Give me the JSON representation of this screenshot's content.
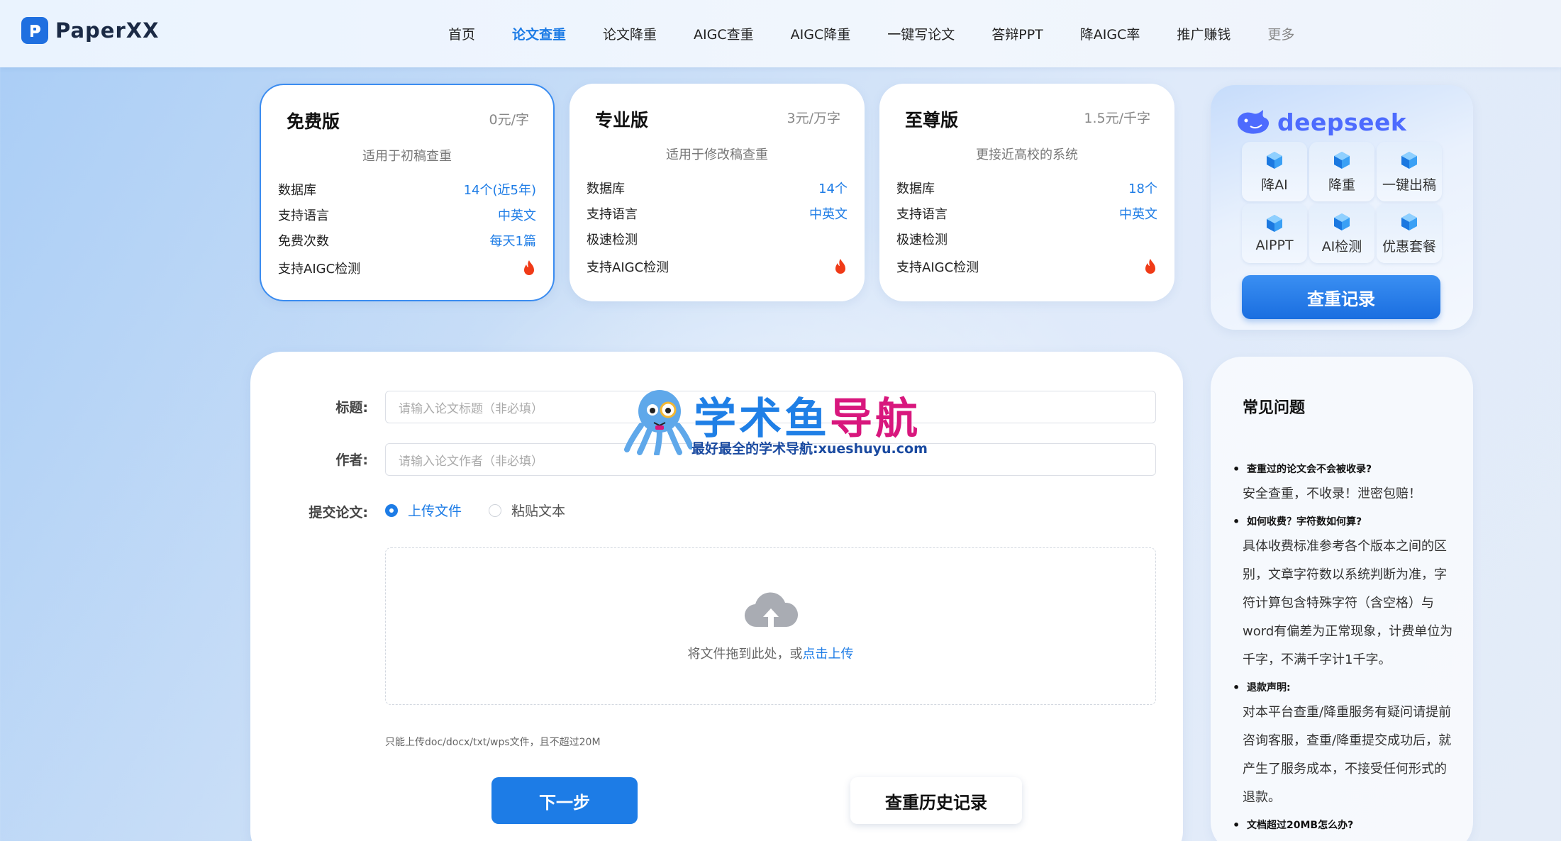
{
  "header": {
    "logo_text": "PaperXX",
    "nav": [
      "首页",
      "论文查重",
      "论文降重",
      "AIGC查重",
      "AIGC降重",
      "一键写论文",
      "答辩PPT",
      "降AIGC率",
      "推广赚钱",
      "更多"
    ],
    "active_index": 1
  },
  "plans": [
    {
      "name": "免费版",
      "price": "0元/字",
      "desc": "适用于初稿查重",
      "rows": [
        {
          "label": "数据库",
          "value": "14个(近5年)"
        },
        {
          "label": "支持语言",
          "value": "中英文"
        },
        {
          "label": "免费次数",
          "value": "每天1篇"
        },
        {
          "label": "支持AIGC检测",
          "value": ""
        }
      ]
    },
    {
      "name": "专业版",
      "price": "3元/万字",
      "desc": "适用于修改稿查重",
      "rows": [
        {
          "label": "数据库",
          "value": "14个"
        },
        {
          "label": "支持语言",
          "value": "中英文"
        },
        {
          "label": "极速检测",
          "value": ""
        },
        {
          "label": "支持AIGC检测",
          "value": ""
        }
      ]
    },
    {
      "name": "至尊版",
      "price": "1.5元/千字",
      "desc": "更接近高校的系统",
      "rows": [
        {
          "label": "数据库",
          "value": "18个"
        },
        {
          "label": "支持语言",
          "value": "中英文"
        },
        {
          "label": "极速检测",
          "value": ""
        },
        {
          "label": "支持AIGC检测",
          "value": ""
        }
      ]
    }
  ],
  "deepseek": {
    "logo_text": "deepseek",
    "tiles": [
      "降AI",
      "降重",
      "一键出稿",
      "AIPPT",
      "AI检测",
      "优惠套餐"
    ],
    "record_button": "查重记录"
  },
  "form": {
    "title_label": "标题:",
    "title_placeholder": "请输入论文标题（非必填）",
    "author_label": "作者:",
    "author_placeholder": "请输入论文作者（非必填）",
    "submit_label": "提交论文:",
    "option_upload": "上传文件",
    "option_paste": "粘贴文本",
    "upload_hint": "将文件拖到此处，或",
    "upload_link": "点击上传",
    "upload_note": "只能上传doc/docx/txt/wps文件，且不超过20M",
    "next_button": "下一步",
    "history_button": "查重历史记录"
  },
  "faq": {
    "title": "常见问题",
    "items": [
      {
        "q": "查重过的论文会不会被收录?",
        "a": "安全查重，不收录！泄密包赔！"
      },
      {
        "q": "如何收费？字符数如何算?",
        "a": "具体收费标准参考各个版本之间的区别，文章字符数以系统判断为准，字符计算包含特殊字符（含空格）与word有偏差为正常现象，计费单位为千字，不满千字计1千字。"
      },
      {
        "q": "退款声明:",
        "a": "对本平台查重/降重服务有疑问请提前咨询客服，查重/降重提交成功后，就产生了服务成本，不接受任何形式的退款。"
      },
      {
        "q": "文档超过20MB怎么办?",
        "a": ""
      }
    ]
  },
  "watermark": {
    "title_blue": "学术鱼",
    "title_pink": "导航",
    "subtitle": "最好最全的学术导航:xueshuyu.com"
  },
  "colors": {
    "accent": "#1d7ce6",
    "fire": "#f03a17",
    "deepseek": "#4d6bfe"
  }
}
